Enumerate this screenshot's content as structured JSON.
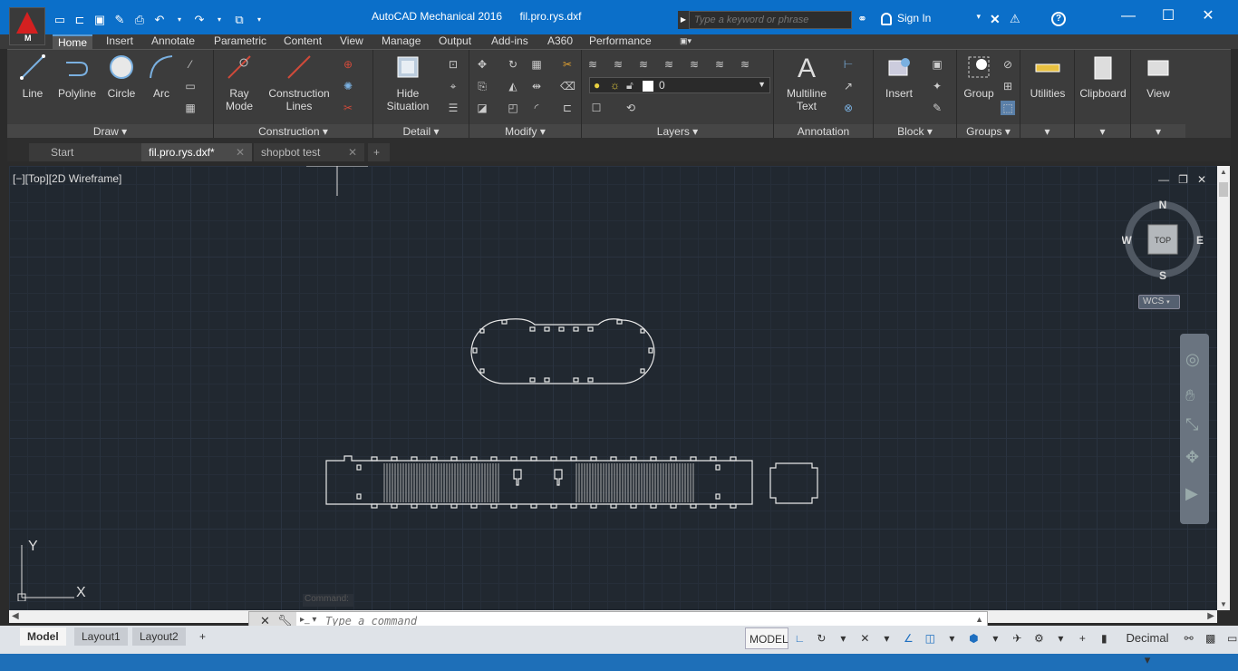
{
  "titlebar": {
    "app_name": "AutoCAD Mechanical 2016",
    "file_name": "fil.pro.rys.dxf",
    "search_placeholder": "Type a keyword or phrase",
    "signin_label": "Sign In",
    "logo_letter": "M"
  },
  "ribbon_tabs": [
    "Home",
    "Insert",
    "Annotate",
    "Parametric",
    "Content",
    "View",
    "Manage",
    "Output",
    "Add-ins",
    "A360",
    "Performance"
  ],
  "ribbon": {
    "draw": {
      "title": "Draw",
      "line": "Line",
      "polyline": "Polyline",
      "circle": "Circle",
      "arc": "Arc"
    },
    "construction": {
      "title": "Construction",
      "ray_mode_1": "Ray",
      "ray_mode_2": "Mode",
      "construction_lines_1": "Construction",
      "construction_lines_2": "Lines"
    },
    "detail": {
      "title": "Detail",
      "hide_situation_1": "Hide",
      "hide_situation_2": "Situation"
    },
    "modify": {
      "title": "Modify"
    },
    "layers": {
      "title": "Layers",
      "current_layer": "0"
    },
    "annotation": {
      "title": "Annotation",
      "multiline_text_1": "Multiline",
      "multiline_text_2": "Text"
    },
    "block": {
      "title": "Block",
      "insert": "Insert"
    },
    "groups": {
      "title": "Groups",
      "group": "Group"
    },
    "utilities": "Utilities",
    "clipboard": "Clipboard",
    "view": "View"
  },
  "file_tabs": [
    {
      "label": "Start"
    },
    {
      "label": "fil.pro.rys.dxf*"
    },
    {
      "label": "shopbot test"
    }
  ],
  "viewport": {
    "view_label": "[−][Top][2D Wireframe]",
    "compass": {
      "n": "N",
      "s": "S",
      "e": "E",
      "w": "W",
      "cube_face": "TOP"
    },
    "wcs_label": "WCS",
    "ucs_x": "X",
    "ucs_y": "Y",
    "cmd_ghost": "Command:"
  },
  "command_line": {
    "placeholder": "Type a command"
  },
  "layout_tabs": [
    "Model",
    "Layout1",
    "Layout2"
  ],
  "status_bar": {
    "model_label": "MODEL",
    "units": "Decimal"
  },
  "colors": {
    "titlebar": "#0b6fc9",
    "ribbon_bg": "#3c3c3c",
    "drawing_bg": "#212830",
    "accent": "#1e6fc0"
  }
}
